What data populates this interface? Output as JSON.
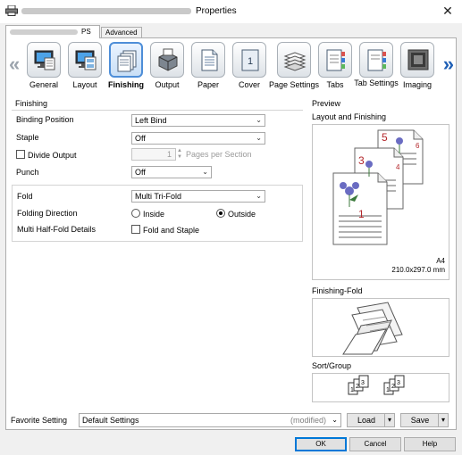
{
  "window": {
    "title": "Properties",
    "close": "✕"
  },
  "tabs": [
    {
      "label": "PS"
    },
    {
      "label": "Advanced"
    }
  ],
  "nav": {
    "left_arrow": "«",
    "right_arrow": "»",
    "items": [
      {
        "label": "General",
        "icon": "general-icon"
      },
      {
        "label": "Layout",
        "icon": "layout-icon"
      },
      {
        "label": "Finishing",
        "icon": "finishing-icon",
        "active": true
      },
      {
        "label": "Output",
        "icon": "output-icon"
      },
      {
        "label": "Paper",
        "icon": "paper-icon"
      },
      {
        "label": "Cover",
        "icon": "cover-icon"
      },
      {
        "label": "Page Settings",
        "icon": "page-settings-icon"
      },
      {
        "label": "Tabs",
        "icon": "tabs-icon"
      },
      {
        "label": "Tab Settings",
        "icon": "tab-settings-icon"
      },
      {
        "label": "Imaging",
        "icon": "imaging-icon"
      }
    ]
  },
  "finishing": {
    "group_label": "Finishing",
    "binding_position": {
      "label": "Binding Position",
      "value": "Left Bind"
    },
    "staple": {
      "label": "Staple",
      "value": "Off"
    },
    "divide_output": {
      "label": "Divide Output",
      "checked": false,
      "value": "1",
      "suffix": "Pages per Section"
    },
    "punch": {
      "label": "Punch",
      "value": "Off"
    },
    "fold": {
      "label": "Fold",
      "value": "Multi Tri-Fold"
    },
    "folding_direction": {
      "label": "Folding Direction",
      "inside": "Inside",
      "outside": "Outside",
      "selected": "outside"
    },
    "multi_half_fold": {
      "label": "Multi Half-Fold Details",
      "option": "Fold and Staple",
      "checked": false
    }
  },
  "preview": {
    "title": "Preview",
    "layout_title": "Layout and Finishing",
    "page_numbers": [
      "1",
      "3",
      "4",
      "5",
      "6"
    ],
    "paper_size": "A4",
    "paper_dims": "210.0x297.0 mm",
    "fold_title": "Finishing-Fold",
    "sort_title": "Sort/Group",
    "sort_numbers": [
      "1",
      "2",
      "3"
    ]
  },
  "favorite": {
    "label": "Favorite Setting",
    "value": "Default Settings",
    "modified": "(modified)",
    "load": "Load",
    "save": "Save"
  },
  "buttons": {
    "ok": "OK",
    "cancel": "Cancel",
    "help": "Help"
  },
  "colors": {
    "accent": "#0078d7",
    "active_tile": "#4e8ed8",
    "page_number": "#b3262a",
    "nav_arrow": "#1f5fb5"
  }
}
